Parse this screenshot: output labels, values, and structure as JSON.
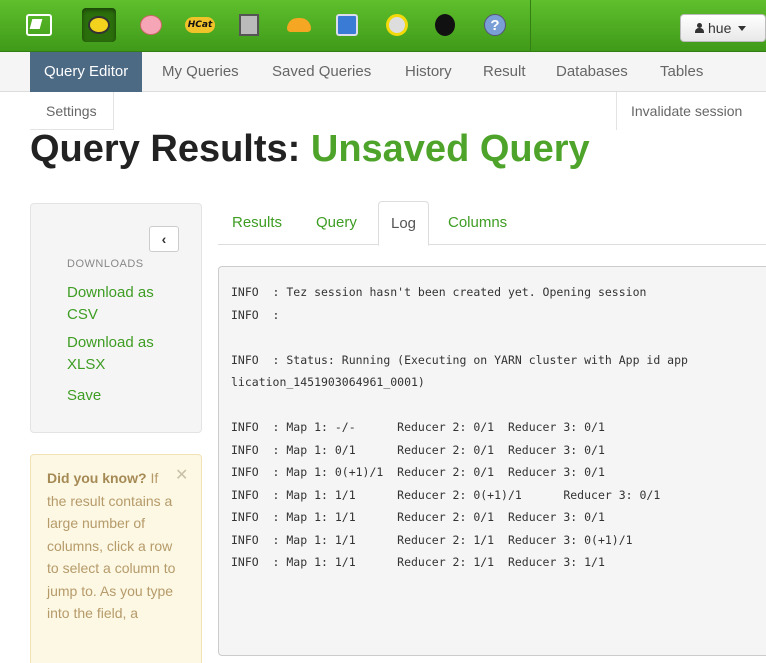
{
  "user": {
    "name": "hue"
  },
  "subnav": {
    "items": [
      "Query Editor",
      "My Queries",
      "Saved Queries",
      "History",
      "Result",
      "Databases",
      "Tables"
    ],
    "settings": "Settings",
    "invalidate": "Invalidate session"
  },
  "page": {
    "title_prefix": "Query Results:",
    "title_name": "Unsaved Query"
  },
  "sidebar": {
    "downloads_header": "DOWNLOADS",
    "download_csv": "Download as CSV",
    "download_xlsx": "Download as XLSX",
    "save": "Save"
  },
  "tip": {
    "heading": "Did you know?",
    "body": " If the result contains a large number of columns, click a row to select a column to jump to. As you type into the field, a"
  },
  "tabs": [
    "Results",
    "Query",
    "Log",
    "Columns"
  ],
  "log": [
    "INFO  : Tez session hasn't been created yet. Opening session",
    "INFO  :",
    "",
    "INFO  : Status: Running (Executing on YARN cluster with App id app",
    "lication_1451903064961_0001)",
    "",
    "INFO  : Map 1: -/-      Reducer 2: 0/1  Reducer 3: 0/1",
    "INFO  : Map 1: 0/1      Reducer 2: 0/1  Reducer 3: 0/1",
    "INFO  : Map 1: 0(+1)/1  Reducer 2: 0/1  Reducer 3: 0/1",
    "INFO  : Map 1: 1/1      Reducer 2: 0(+1)/1      Reducer 3: 0/1",
    "INFO  : Map 1: 1/1      Reducer 2: 0/1  Reducer 3: 0/1",
    "INFO  : Map 1: 1/1      Reducer 2: 1/1  Reducer 3: 0(+1)/1",
    "INFO  : Map 1: 1/1      Reducer 2: 1/1  Reducer 3: 1/1"
  ],
  "icons": {
    "apps": [
      "home-icon",
      "beeswax-icon",
      "pig-icon",
      "hcatalog-icon",
      "sqoop-icon",
      "impala-icon",
      "file-browser-icon",
      "job-browser-icon",
      "oozie-icon",
      "help-icon"
    ]
  },
  "colors": {
    "topbar": "#4fae22",
    "accent_green": "#4ea42a",
    "active_tab": "#4d6a85"
  }
}
